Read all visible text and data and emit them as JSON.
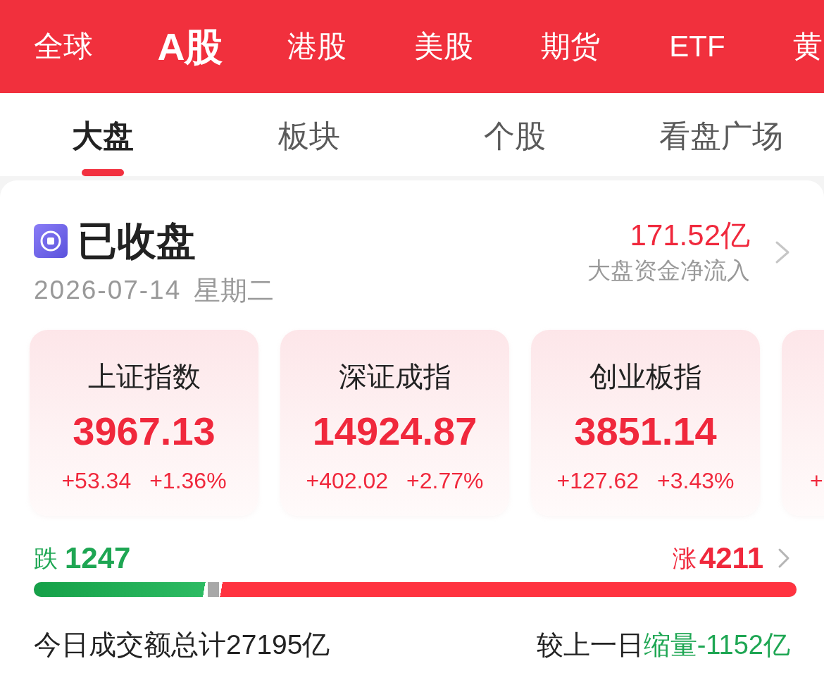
{
  "market_tabs": [
    {
      "label": "全球",
      "selected": false
    },
    {
      "label": "A股",
      "selected": true
    },
    {
      "label": "港股",
      "selected": false
    },
    {
      "label": "美股",
      "selected": false
    },
    {
      "label": "期货",
      "selected": false
    },
    {
      "label": "ETF",
      "selected": false
    },
    {
      "label": "黄",
      "selected": false
    }
  ],
  "sub_tabs": [
    {
      "label": "大盘",
      "selected": true
    },
    {
      "label": "板块",
      "selected": false
    },
    {
      "label": "个股",
      "selected": false
    },
    {
      "label": "看盘广场",
      "selected": false
    }
  ],
  "status": {
    "title": "已收盘",
    "date": "2026-07-14",
    "weekday": "星期二",
    "net_inflow": "171.52亿",
    "net_inflow_label": "大盘资金净流入"
  },
  "indices": [
    {
      "kind": "full",
      "name": "上证指数",
      "value": "3967.13",
      "change": "+53.34",
      "pct": "+1.36%"
    },
    {
      "kind": "full",
      "name": "深证成指",
      "value": "14924.87",
      "change": "+402.02",
      "pct": "+2.77%"
    },
    {
      "kind": "full",
      "name": "创业板指",
      "value": "3851.14",
      "change": "+127.62",
      "pct": "+3.43%"
    },
    {
      "kind": "cut",
      "change": "+"
    }
  ],
  "breadth": {
    "fall": {
      "label": "跌",
      "count": "1247",
      "level": 0.228
    },
    "rise": {
      "label": "涨",
      "count": "4211",
      "level": 0.757
    }
  },
  "turnover": {
    "total": "今日成交额总计27195亿",
    "compare_label": "较上一日",
    "compare_value": "缩量-1152亿"
  }
}
